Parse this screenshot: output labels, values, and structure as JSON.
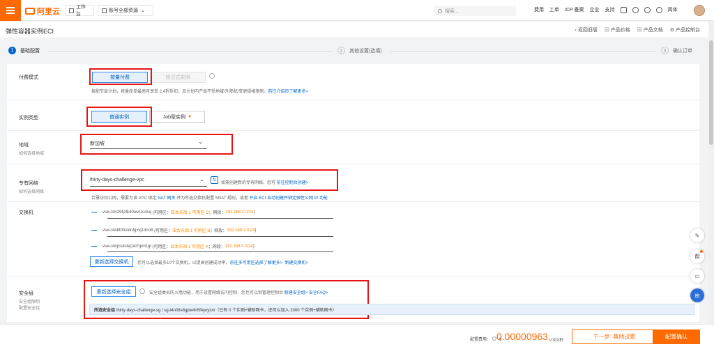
{
  "topbar": {
    "logo_text": "阿里云",
    "workbench": "工作台",
    "account_selector": "账号全部资源",
    "search_placeholder": "搜索...",
    "links": [
      "费用",
      "工单",
      "ICP 备案",
      "企业",
      "支持"
    ],
    "lang": "简体"
  },
  "header": {
    "title": "弹性容器实例ECI",
    "actions": [
      "返回旧版",
      "产品价格",
      "产品文档",
      "产品控制台"
    ]
  },
  "steps": [
    {
      "num": "1",
      "label": "基础配置",
      "active": true
    },
    {
      "num": "2",
      "label": "其他设置(选填)",
      "active": false
    },
    {
      "num": "3",
      "label": "确认订单",
      "active": false
    }
  ],
  "billing": {
    "label": "付费模式",
    "opt_selected": "按量付费",
    "opt_disabled": "抢占式实例",
    "note": "按配节省计划，按量库单最高可享受 2.4折折扣，且计划内产品不受地域/升降配/变更规格限制，",
    "note_link": "前往介绍页了解更多>"
  },
  "instance_type": {
    "label": "实例类型",
    "opt_selected": "普通实例",
    "opt_other": "Job型实例"
  },
  "region": {
    "label": "地域",
    "sub": "如何选择地域",
    "value": "新加坡"
  },
  "vpc": {
    "label": "专有网络",
    "sub": "如何选择网络",
    "value": "thirty-days-challenge-vpc",
    "hint": "如需创建新的专有网络，您可",
    "hint_link": "前往控制台创建>",
    "note_pre": "若需访问公网，需要为该 VPC 绑定",
    "note_nat": "NAT 网关",
    "note_mid": "并为所选交换机配置 SNAT 规则，或者",
    "note_eip": "开启 ECI 自动创建并绑定弹性公网 IP 功能"
  },
  "vswitch": {
    "label": "交换机",
    "items": [
      {
        "id": "vsw-t4n29fjzfk40wv1tc4raj",
        "zone_pre": "(可用区：",
        "zone": "亚太东南 1 可用区 C",
        "net_pre": "；网段：",
        "net": "192.168.2.0/24",
        "close": ")"
      },
      {
        "id": "vsw-t4n8t0hcidnfgxvj13no8",
        "zone_pre": "(可用区：",
        "zone": "亚太东南 1 可用区 B",
        "net_pre": "；网段：",
        "net": "192.168.1.0/24",
        "close": ")"
      },
      {
        "id": "vsw-t4njcs4stej1el7qml1gl",
        "zone_pre": "(可用区：",
        "zone": "亚太东南 1 可用区 A",
        "net_pre": "；网段：",
        "net": "192.168.0.0/24",
        "close": ")"
      }
    ],
    "reselect_btn": "重新选择交换机",
    "hint": "您可以选择最多10个交换机，以提高创建成功率。",
    "hint_link1": "前往多可用区选择了解更多>",
    "hint_link2": "新建交换机>"
  },
  "security_group": {
    "label": "安全组",
    "sub1": "安全组限制",
    "sub2": "配置安全组",
    "reselect_btn": "重新选择安全组",
    "hint": "安全组类似防火墙功能，用于设置网络访问控制，您也可以到管理控制台",
    "hint_link1": "新建安全组>",
    "hint_link2": "安全FAQ>",
    "selected_label": "所选安全组",
    "selected_value": "thirty-days-challenge-sg / sg-t4n08s8gpw4n5f4yoyzm（已有 0 个实例+辅助网卡，还可以加入 2000 个实例+辅助网卡）"
  },
  "footer": {
    "price_label": "配置费用：",
    "price_currency": "$",
    "price_value": "0.00000963",
    "price_unit": "USD/秒",
    "next_btn": "下一步: 其他设置",
    "confirm_btn": "配置确认"
  },
  "floating": [
    "编辑",
    "帮",
    "消息",
    "应用"
  ],
  "colors": {
    "brand": "#ff6a00",
    "link": "#0064c8",
    "highlight": "#e81414"
  }
}
